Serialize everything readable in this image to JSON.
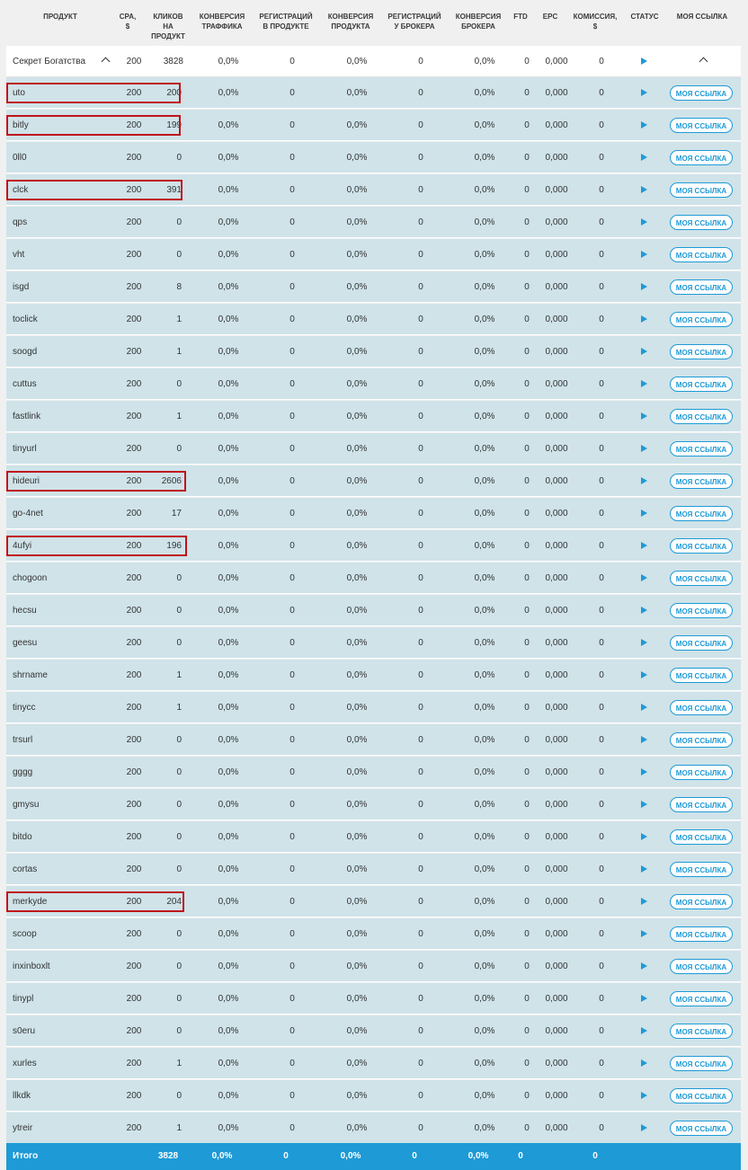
{
  "columns": {
    "product": "ПРОДУКТ",
    "cpa": "CPA,\n$",
    "clicks": "КЛИКОВ\nНА\nПРОДУКТ",
    "conv_traffic": "КОНВЕРСИЯ\nТРАФФИКА",
    "reg_product": "РЕГИСТРАЦИЙ\nВ ПРОДУКТЕ",
    "conv_product": "КОНВЕРСИЯ\nПРОДУКТА",
    "reg_broker": "РЕГИСТРАЦИЙ\nУ БРОКЕРА",
    "conv_broker": "КОНВЕРСИЯ\nБРОКЕРА",
    "ftd": "FTD",
    "epc": "EPC",
    "commission": "КОМИССИЯ,\n$",
    "status": "СТАТУС",
    "my_link": "МОЯ ССЫЛКА"
  },
  "parent": {
    "name": "Секрет Богатства",
    "cpa": "200",
    "clicks": "3828",
    "conv_traffic": "0,0%",
    "reg_product": "0",
    "conv_product": "0,0%",
    "reg_broker": "0",
    "conv_broker": "0,0%",
    "ftd": "0",
    "epc": "0,000",
    "commission": "0"
  },
  "rows": [
    {
      "name": "uto",
      "cpa": "200",
      "clicks": "200",
      "highlighted": true
    },
    {
      "name": "bitly",
      "cpa": "200",
      "clicks": "199",
      "highlighted": true
    },
    {
      "name": "0ll0",
      "cpa": "200",
      "clicks": "0",
      "highlighted": false
    },
    {
      "name": "clck",
      "cpa": "200",
      "clicks": "391",
      "highlighted": true
    },
    {
      "name": "qps",
      "cpa": "200",
      "clicks": "0",
      "highlighted": false
    },
    {
      "name": "vht",
      "cpa": "200",
      "clicks": "0",
      "highlighted": false
    },
    {
      "name": "isgd",
      "cpa": "200",
      "clicks": "8",
      "highlighted": false
    },
    {
      "name": "toclick",
      "cpa": "200",
      "clicks": "1",
      "highlighted": false
    },
    {
      "name": "soogd",
      "cpa": "200",
      "clicks": "1",
      "highlighted": false
    },
    {
      "name": "cuttus",
      "cpa": "200",
      "clicks": "0",
      "highlighted": false
    },
    {
      "name": "fastlink",
      "cpa": "200",
      "clicks": "1",
      "highlighted": false
    },
    {
      "name": "tinyurl",
      "cpa": "200",
      "clicks": "0",
      "highlighted": false
    },
    {
      "name": "hideuri",
      "cpa": "200",
      "clicks": "2606",
      "highlighted": true
    },
    {
      "name": "go-4net",
      "cpa": "200",
      "clicks": "17",
      "highlighted": false
    },
    {
      "name": "4ufyi",
      "cpa": "200",
      "clicks": "196",
      "highlighted": true
    },
    {
      "name": "chogoon",
      "cpa": "200",
      "clicks": "0",
      "highlighted": false
    },
    {
      "name": "hecsu",
      "cpa": "200",
      "clicks": "0",
      "highlighted": false
    },
    {
      "name": "geesu",
      "cpa": "200",
      "clicks": "0",
      "highlighted": false
    },
    {
      "name": "shrname",
      "cpa": "200",
      "clicks": "1",
      "highlighted": false
    },
    {
      "name": "tinycc",
      "cpa": "200",
      "clicks": "1",
      "highlighted": false
    },
    {
      "name": "trsurl",
      "cpa": "200",
      "clicks": "0",
      "highlighted": false
    },
    {
      "name": "gggg",
      "cpa": "200",
      "clicks": "0",
      "highlighted": false
    },
    {
      "name": "gmysu",
      "cpa": "200",
      "clicks": "0",
      "highlighted": false
    },
    {
      "name": "bitdo",
      "cpa": "200",
      "clicks": "0",
      "highlighted": false
    },
    {
      "name": "cortas",
      "cpa": "200",
      "clicks": "0",
      "highlighted": false
    },
    {
      "name": "merkyde",
      "cpa": "200",
      "clicks": "204",
      "highlighted": true
    },
    {
      "name": "scoop",
      "cpa": "200",
      "clicks": "0",
      "highlighted": false
    },
    {
      "name": "inxinboxlt",
      "cpa": "200",
      "clicks": "0",
      "highlighted": false
    },
    {
      "name": "tinypl",
      "cpa": "200",
      "clicks": "0",
      "highlighted": false
    },
    {
      "name": "s0eru",
      "cpa": "200",
      "clicks": "0",
      "highlighted": false
    },
    {
      "name": "xurles",
      "cpa": "200",
      "clicks": "1",
      "highlighted": false
    },
    {
      "name": "llkdk",
      "cpa": "200",
      "clicks": "0",
      "highlighted": false
    },
    {
      "name": "ytreir",
      "cpa": "200",
      "clicks": "1",
      "highlighted": false
    }
  ],
  "row_defaults": {
    "conv_traffic": "0,0%",
    "reg_product": "0",
    "conv_product": "0,0%",
    "reg_broker": "0",
    "conv_broker": "0,0%",
    "ftd": "0",
    "epc": "0,000",
    "commission": "0",
    "link_label": "МОЯ ССЫЛКА"
  },
  "total": {
    "label": "Итого",
    "clicks": "3828",
    "conv_traffic": "0,0%",
    "reg_product": "0",
    "conv_product": "0,0%",
    "reg_broker": "0",
    "conv_broker": "0,0%",
    "ftd": "0",
    "commission": "0"
  },
  "colors": {
    "accent": "#1e9ad6",
    "row_bg": "#cfe3e9",
    "highlight": "#c0131a"
  },
  "icons": {
    "status": "play-icon",
    "collapse": "chevron-up-icon"
  }
}
